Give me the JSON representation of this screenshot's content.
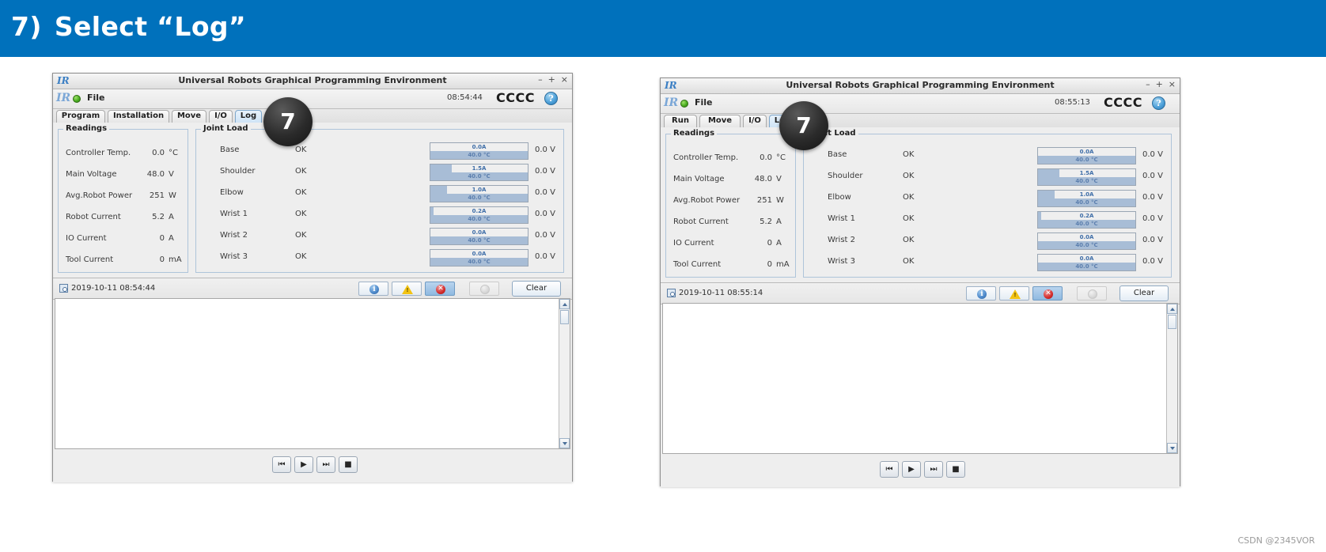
{
  "banner": {
    "step_number": "7)",
    "instruction": "Select “Log”"
  },
  "callout": {
    "label": "7"
  },
  "watermark": "CSDN @2345VOR",
  "icons": {
    "window_minimize": "–",
    "window_maximize": "+",
    "window_close": "×",
    "ur_logo": "IR",
    "help": "?",
    "info": "i",
    "error": "✕",
    "skip_back": "⏮",
    "play": "▶",
    "skip_forward": "⏭",
    "stop": "■",
    "date_icon": "calendar-clock-icon"
  },
  "readings": {
    "group_title": "Readings",
    "rows": [
      {
        "label": "Controller Temp.",
        "value": "0.0",
        "unit": "°C"
      },
      {
        "label": "Main Voltage",
        "value": "48.0",
        "unit": "V"
      },
      {
        "label": "Avg.Robot Power",
        "value": "251",
        "unit": "W"
      },
      {
        "label": "Robot Current",
        "value": "5.2",
        "unit": "A"
      },
      {
        "label": "IO Current",
        "value": "0",
        "unit": "A"
      },
      {
        "label": "Tool Current",
        "value": "0",
        "unit": "mA"
      }
    ]
  },
  "joint_load": {
    "group_title": "Joint Load",
    "joints": [
      {
        "name": "Base",
        "status": "OK",
        "current": "0.0A",
        "current_pct": 0,
        "temp": "40.0 °C",
        "temp_pct": 100,
        "voltage": "0.0 V"
      },
      {
        "name": "Shoulder",
        "status": "OK",
        "current": "1.5A",
        "current_pct": 22,
        "temp": "40.0 °C",
        "temp_pct": 100,
        "voltage": "0.0 V"
      },
      {
        "name": "Elbow",
        "status": "OK",
        "current": "1.0A",
        "current_pct": 17,
        "temp": "40.0 °C",
        "temp_pct": 100,
        "voltage": "0.0 V"
      },
      {
        "name": "Wrist 1",
        "status": "OK",
        "current": "0.2A",
        "current_pct": 3,
        "temp": "40.0 °C",
        "temp_pct": 100,
        "voltage": "0.0 V"
      },
      {
        "name": "Wrist 2",
        "status": "OK",
        "current": "0.0A",
        "current_pct": 0,
        "temp": "40.0 °C",
        "temp_pct": 100,
        "voltage": "0.0 V"
      },
      {
        "name": "Wrist 3",
        "status": "OK",
        "current": "0.0A",
        "current_pct": 0,
        "temp": "40.0 °C",
        "temp_pct": 100,
        "voltage": "0.0 V"
      }
    ]
  },
  "log_toolbar": {
    "clear_label": "Clear",
    "filters": [
      {
        "name": "info",
        "selected": false,
        "enabled": true
      },
      {
        "name": "warning",
        "selected": false,
        "enabled": true
      },
      {
        "name": "error",
        "selected": true,
        "enabled": true
      },
      {
        "name": "muted",
        "selected": false,
        "enabled": false
      }
    ]
  },
  "windows": [
    {
      "id": "left",
      "title": "Universal Robots Graphical Programming Environment",
      "menu": {
        "file": "File",
        "time": "08:54:44",
        "robot": "CCCC"
      },
      "tabs": [
        {
          "label": "Program",
          "active": false
        },
        {
          "label": "Installation",
          "active": false
        },
        {
          "label": "Move",
          "active": false
        },
        {
          "label": "I/O",
          "active": false
        },
        {
          "label": "Log",
          "active": true
        }
      ],
      "log_date": "2019-10-11 08:54:44"
    },
    {
      "id": "right",
      "title": "Universal Robots Graphical Programming Environment",
      "menu": {
        "file": "File",
        "time": "08:55:13",
        "robot": "CCCC"
      },
      "tabs": [
        {
          "label": "Run",
          "active": false
        },
        {
          "label": "Move",
          "active": false
        },
        {
          "label": "I/O",
          "active": false
        },
        {
          "label": "Log",
          "active": true
        }
      ],
      "log_date": "2019-10-11 08:55:14"
    }
  ],
  "colors": {
    "banner_blue": "#0071bc",
    "tab_active": "#cfe4f6",
    "gauge_fill": "#a8bdd6",
    "error_red": "#d32b2b",
    "warn_yellow": "#f2c313",
    "info_blue": "#4b87c9"
  }
}
